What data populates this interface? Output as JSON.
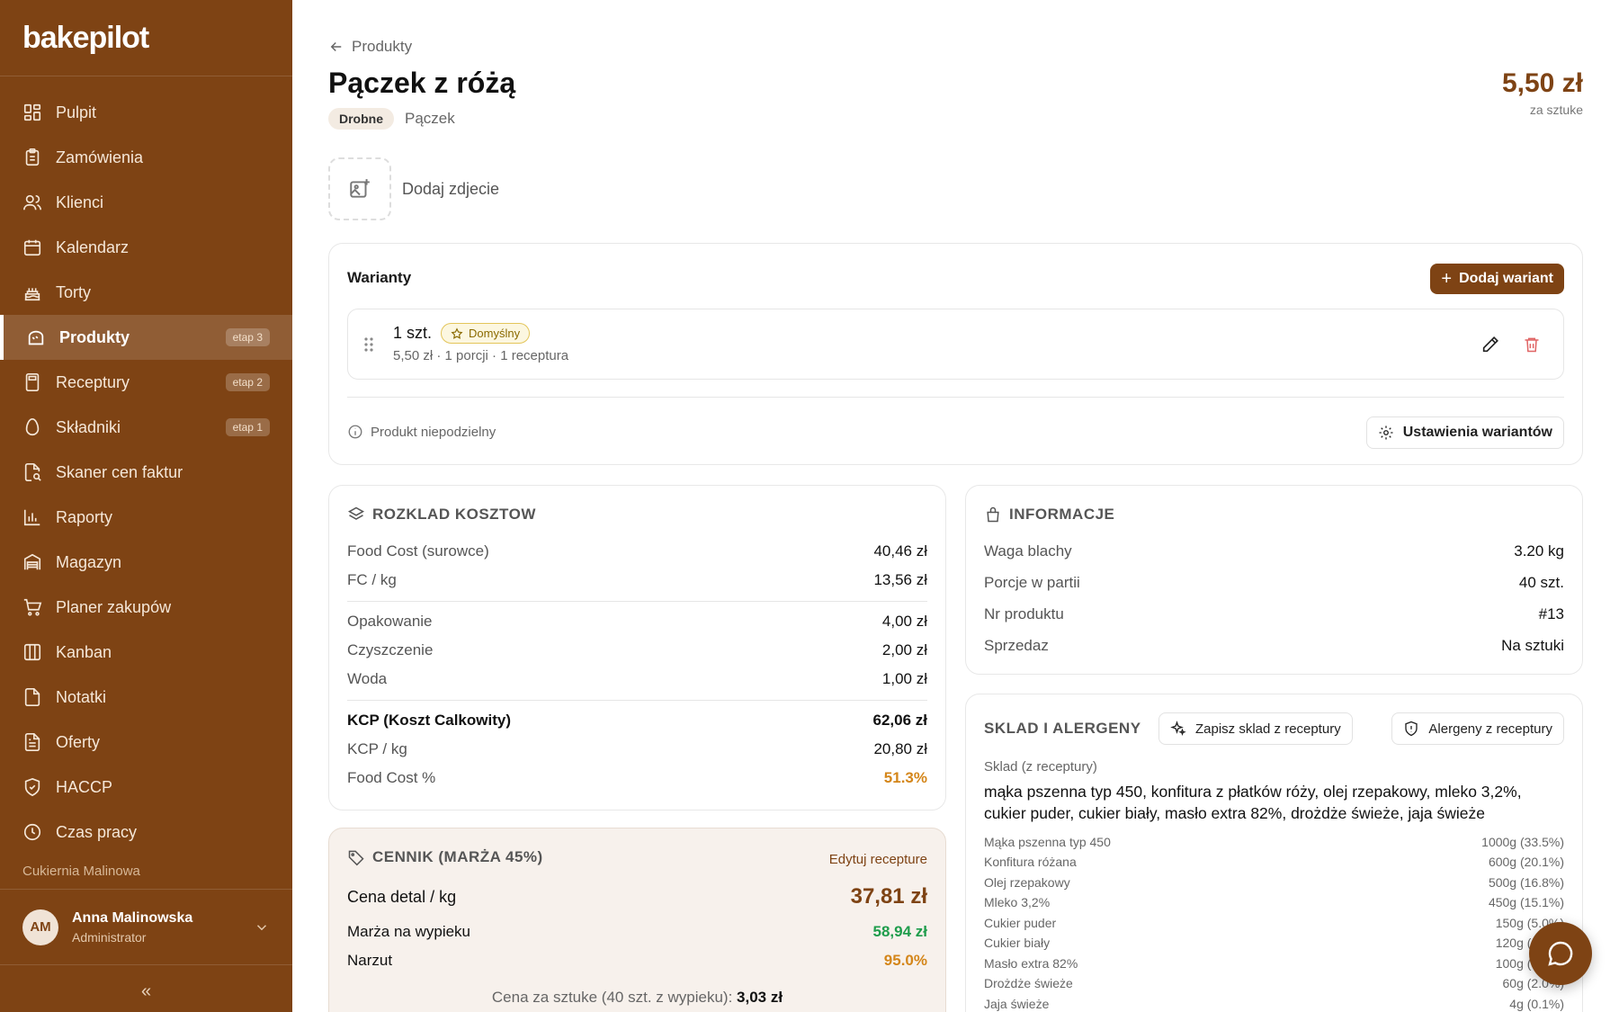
{
  "brand": {
    "name": "bakepilot",
    "accent": "#7e4314"
  },
  "sidebar": {
    "items": [
      {
        "label": "Pulpit",
        "icon": "grid-icon"
      },
      {
        "label": "Zamówienia",
        "icon": "clipboard-icon"
      },
      {
        "label": "Klienci",
        "icon": "users-icon"
      },
      {
        "label": "Kalendarz",
        "icon": "calendar-icon"
      },
      {
        "label": "Torty",
        "icon": "cake-icon"
      },
      {
        "label": "Produkty",
        "icon": "bread-icon",
        "badge": "etap 3",
        "active": true
      },
      {
        "label": "Receptury",
        "icon": "calculator-icon",
        "badge": "etap 2"
      },
      {
        "label": "Składniki",
        "icon": "egg-icon",
        "badge": "etap 1"
      },
      {
        "label": "Skaner cen faktur",
        "icon": "file-scan-icon"
      },
      {
        "label": "Raporty",
        "icon": "bar-chart-icon"
      },
      {
        "label": "Magazyn",
        "icon": "warehouse-icon"
      },
      {
        "label": "Planer zakupów",
        "icon": "cart-icon"
      },
      {
        "label": "Kanban",
        "icon": "columns-icon"
      },
      {
        "label": "Notatki",
        "icon": "note-icon"
      },
      {
        "label": "Oferty",
        "icon": "document-icon"
      },
      {
        "label": "HACCP",
        "icon": "shield-check-icon"
      },
      {
        "label": "Czas pracy",
        "icon": "clock-icon"
      }
    ],
    "org": "Cukiernia Malinowa",
    "user": {
      "initials": "AM",
      "name": "Anna Malinowska",
      "role": "Administrator"
    },
    "collapse": "«"
  },
  "header": {
    "back": "Produkty",
    "title": "Pączek z różą",
    "tag": "Drobne",
    "category": "Pączek",
    "price": "5,50 zł",
    "price_unit": "za sztuke",
    "add_photo": "Dodaj zdjecie"
  },
  "variants": {
    "title": "Warianty",
    "add_button": "Dodaj wariant",
    "item": {
      "name": "1 szt.",
      "default_badge": "Domyślny",
      "details": "5,50 zł · 1 porcji · 1 receptura"
    },
    "footer_note": "Produkt niepodzielny",
    "settings_button": "Ustawienia wariantów"
  },
  "costs": {
    "title": "ROZKLAD KOSZTOW",
    "rows": [
      {
        "label": "Food Cost (surowce)",
        "value": "40,46 zł"
      },
      {
        "label": "FC / kg",
        "value": "13,56 zł"
      },
      {
        "label": "Opakowanie",
        "value": "4,00 zł"
      },
      {
        "label": "Czyszczenie",
        "value": "2,00 zł"
      },
      {
        "label": "Woda",
        "value": "1,00 zł"
      },
      {
        "label": "KCP (Koszt Calkowity)",
        "value": "62,06 zł"
      },
      {
        "label": "KCP / kg",
        "value": "20,80 zł"
      },
      {
        "label": "Food Cost %",
        "value": "51.3%"
      }
    ]
  },
  "pricing": {
    "title": "CENNIK (MARŻA 45%)",
    "edit_link": "Edytuj recepture",
    "retail_label": "Cena detal / kg",
    "retail_value": "37,81 zł",
    "margin_label": "Marża na wypieku",
    "margin_value": "58,94 zł",
    "markup_label": "Narzut",
    "markup_value": "95.0%",
    "per_piece_label": "Cena za sztuke (40 szt. z wypieku):",
    "per_piece_value": "3,03 zł",
    "colors": {
      "green": "#1f9d4c",
      "orange": "#d4861a"
    }
  },
  "info": {
    "title": "INFORMACJE",
    "rows": [
      {
        "label": "Waga blachy",
        "value": "3.20 kg"
      },
      {
        "label": "Porcje w partii",
        "value": "40 szt."
      },
      {
        "label": "Nr produktu",
        "value": "#13"
      },
      {
        "label": "Sprzedaz",
        "value": "Na sztuki"
      }
    ]
  },
  "composition": {
    "title": "SKLAD I ALERGENY",
    "save_button": "Zapisz sklad z receptury",
    "allergens_button": "Alergeny z receptury",
    "subtitle": "Sklad (z receptury)",
    "text": "mąka pszenna typ 450, konfitura z płatków róży, olej rzepakowy, mleko 3,2%, cukier puder, cukier biały, masło extra 82%, drożdże świeże, jaja świeże",
    "ingredients": [
      {
        "name": "Mąka pszenna typ 450",
        "amount": "1000g (33.5%)"
      },
      {
        "name": "Konfitura różana",
        "amount": "600g (20.1%)"
      },
      {
        "name": "Olej rzepakowy",
        "amount": "500g (16.8%)"
      },
      {
        "name": "Mleko 3,2%",
        "amount": "450g (15.1%)"
      },
      {
        "name": "Cukier puder",
        "amount": "150g (5.0%)"
      },
      {
        "name": "Cukier biały",
        "amount": "120g (4.0%)"
      },
      {
        "name": "Masło extra 82%",
        "amount": "100g (3.4%)"
      },
      {
        "name": "Drożdże świeże",
        "amount": "60g (2.0%)"
      },
      {
        "name": "Jaja świeże",
        "amount": "4g (0.1%)"
      }
    ]
  }
}
